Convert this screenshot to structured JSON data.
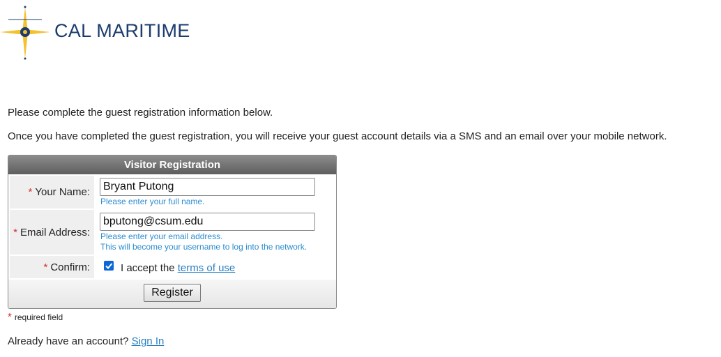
{
  "brand": {
    "name": "CAL MARITIME",
    "logo_icon": "compass-star-icon",
    "colors": {
      "navy": "#1c3c6e",
      "gold": "#f2c230"
    }
  },
  "intro": {
    "line1": "Please complete the guest registration information below.",
    "line2": "Once you have completed the guest registration, you will receive your guest account details via a SMS and an email over your mobile network."
  },
  "form": {
    "title": "Visitor Registration",
    "required_marker": "*",
    "name": {
      "label": "Your Name:",
      "value": "Bryant Putong",
      "hint": "Please enter your full name."
    },
    "email": {
      "label": "Email Address:",
      "value": "bputong@csum.edu",
      "hint1": "Please enter your email address.",
      "hint2": "This will become your username to log into the network."
    },
    "confirm": {
      "label": "Confirm:",
      "checked": true,
      "accept_text": "I accept the",
      "terms_link": "terms of use"
    },
    "register_label": "Register"
  },
  "required_note": "required field",
  "signin": {
    "text": "Already have an account?",
    "link": "Sign In"
  }
}
